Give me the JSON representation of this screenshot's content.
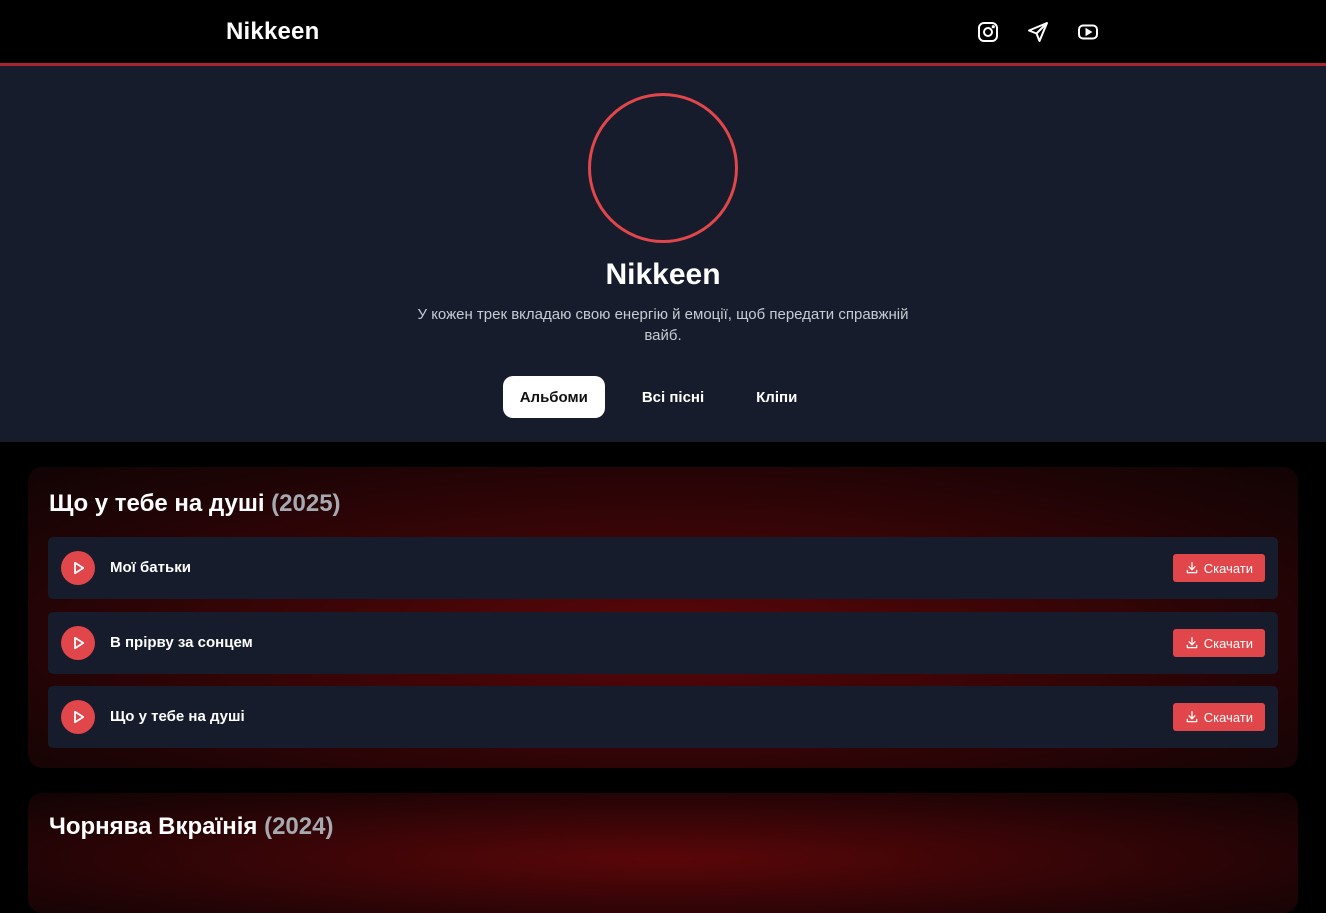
{
  "header": {
    "brand": "Nikkeen",
    "social_icons": [
      "instagram-icon",
      "telegram-icon",
      "youtube-icon"
    ]
  },
  "hero": {
    "name": "Nikkeen",
    "description": "У кожен трек вкладаю свою енергію й емоції, щоб передати справжній вайб.",
    "tabs": [
      {
        "label": "Альбоми",
        "active": true
      },
      {
        "label": "Всі пісні",
        "active": false
      },
      {
        "label": "Кліпи",
        "active": false
      }
    ]
  },
  "albums": [
    {
      "title": "Що у тебе на душі",
      "year": "(2025)",
      "tracks": [
        {
          "title": "Мої батьки",
          "download_label": "Скачати"
        },
        {
          "title": "В прірву за сонцем",
          "download_label": "Скачати"
        },
        {
          "title": "Що у тебе на душі",
          "download_label": "Скачати"
        }
      ]
    },
    {
      "title": "Чорнява Вкраїнія",
      "year": "(2024)",
      "tracks": []
    }
  ],
  "colors": {
    "accent": "#e0464a",
    "panel": "#161c2b",
    "background": "#000000",
    "album_glow": "#5a0608"
  }
}
